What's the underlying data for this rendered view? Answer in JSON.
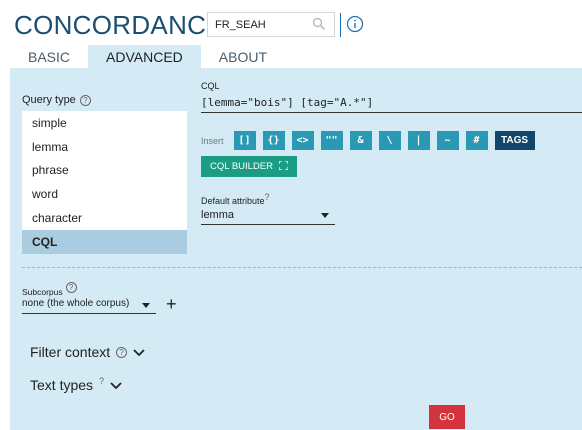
{
  "app": {
    "title": "CONCORDANCE"
  },
  "corpus": {
    "name": "FR_SEAH"
  },
  "tabs": [
    {
      "label": "BASIC",
      "active": false
    },
    {
      "label": "ADVANCED",
      "active": true
    },
    {
      "label": "ABOUT",
      "active": false
    }
  ],
  "query_type": {
    "label": "Query type",
    "options": [
      "simple",
      "lemma",
      "phrase",
      "word",
      "character",
      "CQL"
    ],
    "selected": "CQL"
  },
  "cql": {
    "label": "CQL",
    "value": "[lemma=\"bois\"] [tag=\"A.*\"]"
  },
  "insert": {
    "label": "Insert",
    "buttons": [
      "[]",
      "{}",
      "<>",
      "\"\"",
      "&",
      "\\",
      "|",
      "~",
      "#"
    ],
    "tags_label": "TAGS"
  },
  "cql_builder": {
    "label": "CQL BUILDER"
  },
  "default_attribute": {
    "label": "Default attribute",
    "value": "lemma"
  },
  "subcorpus": {
    "label": "Subcorpus",
    "value": "none (the whole corpus)",
    "add": "+"
  },
  "filter_context": {
    "label": "Filter context"
  },
  "text_types": {
    "label": "Text types"
  },
  "go": {
    "label": "GO"
  },
  "colors": {
    "title": "#1b4f72",
    "panel_bg": "#d4ebf5",
    "insert_btn": "#2a99b3",
    "tags_btn": "#12476b",
    "builder_btn": "#1a9d84",
    "go_btn": "#d2333d",
    "selected_row": "#a9cce0"
  }
}
